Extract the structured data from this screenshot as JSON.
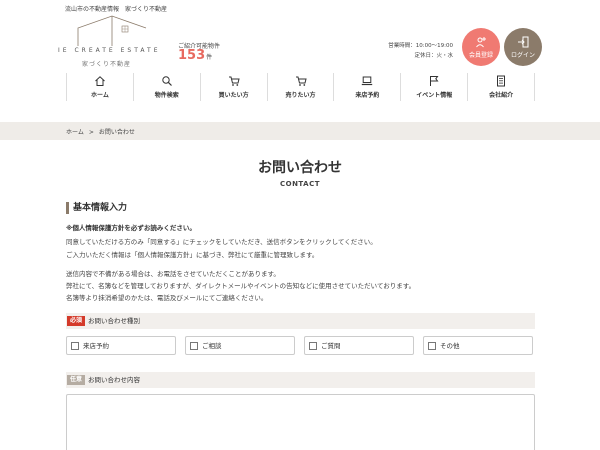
{
  "header": {
    "tagline": "流山市の不動産情報　家づくり不動産",
    "logo_en": "IE CREATE ESTATE",
    "logo_ja": "家づくり不動産",
    "property_count_label": "ご紹介可能物件",
    "property_count": "153",
    "property_count_unit": "件",
    "hours_line": "営業時間：10:00〜19:00",
    "holiday_line": "定休日：火・水",
    "register_label": "会員登録",
    "login_label": "ログイン",
    "accent_color": "#f07a72",
    "brand_color": "#8b7b6a"
  },
  "nav": {
    "items": [
      {
        "label": "ホーム",
        "icon": "home-icon"
      },
      {
        "label": "物件検索",
        "icon": "search-icon"
      },
      {
        "label": "買いたい方",
        "icon": "cart-icon"
      },
      {
        "label": "売りたい方",
        "icon": "cart-icon"
      },
      {
        "label": "来店予約",
        "icon": "laptop-icon"
      },
      {
        "label": "イベント情報",
        "icon": "flag-icon"
      },
      {
        "label": "会社紹介",
        "icon": "document-icon"
      }
    ]
  },
  "breadcrumb": {
    "home": "ホーム",
    "separator": ">",
    "current": "お問い合わせ"
  },
  "page": {
    "title": "お問い合わせ",
    "subtitle": "CONTACT"
  },
  "section": {
    "heading": "基本情報入力",
    "notice": "※個人情報保護方針を必ずお読みください。",
    "lines": [
      "同意していただける方のみ「同意する」にチェックをしていただき、送信ボタンをクリックしてください。",
      "ご入力いただく情報は「個人情報保護方針」に基づき、弊社にて厳重に管理致します。",
      "送信内容で不備がある場合は、お電話をさせていただくことがあります。",
      "弊社にて、名簿などを管理しておりますが、ダイレクトメールやイベントの告知などに使用させていただいております。",
      "名簿等より抹消希望のかたは、電話及びメールにてご連絡ください。"
    ]
  },
  "form": {
    "inquiry_type": {
      "tag": "必須",
      "label": "お問い合わせ種別",
      "options": [
        "来店予約",
        "ご相談",
        "ご質問",
        "その他"
      ]
    },
    "inquiry_content": {
      "tag": "任意",
      "label": "お問い合わせ内容"
    }
  }
}
